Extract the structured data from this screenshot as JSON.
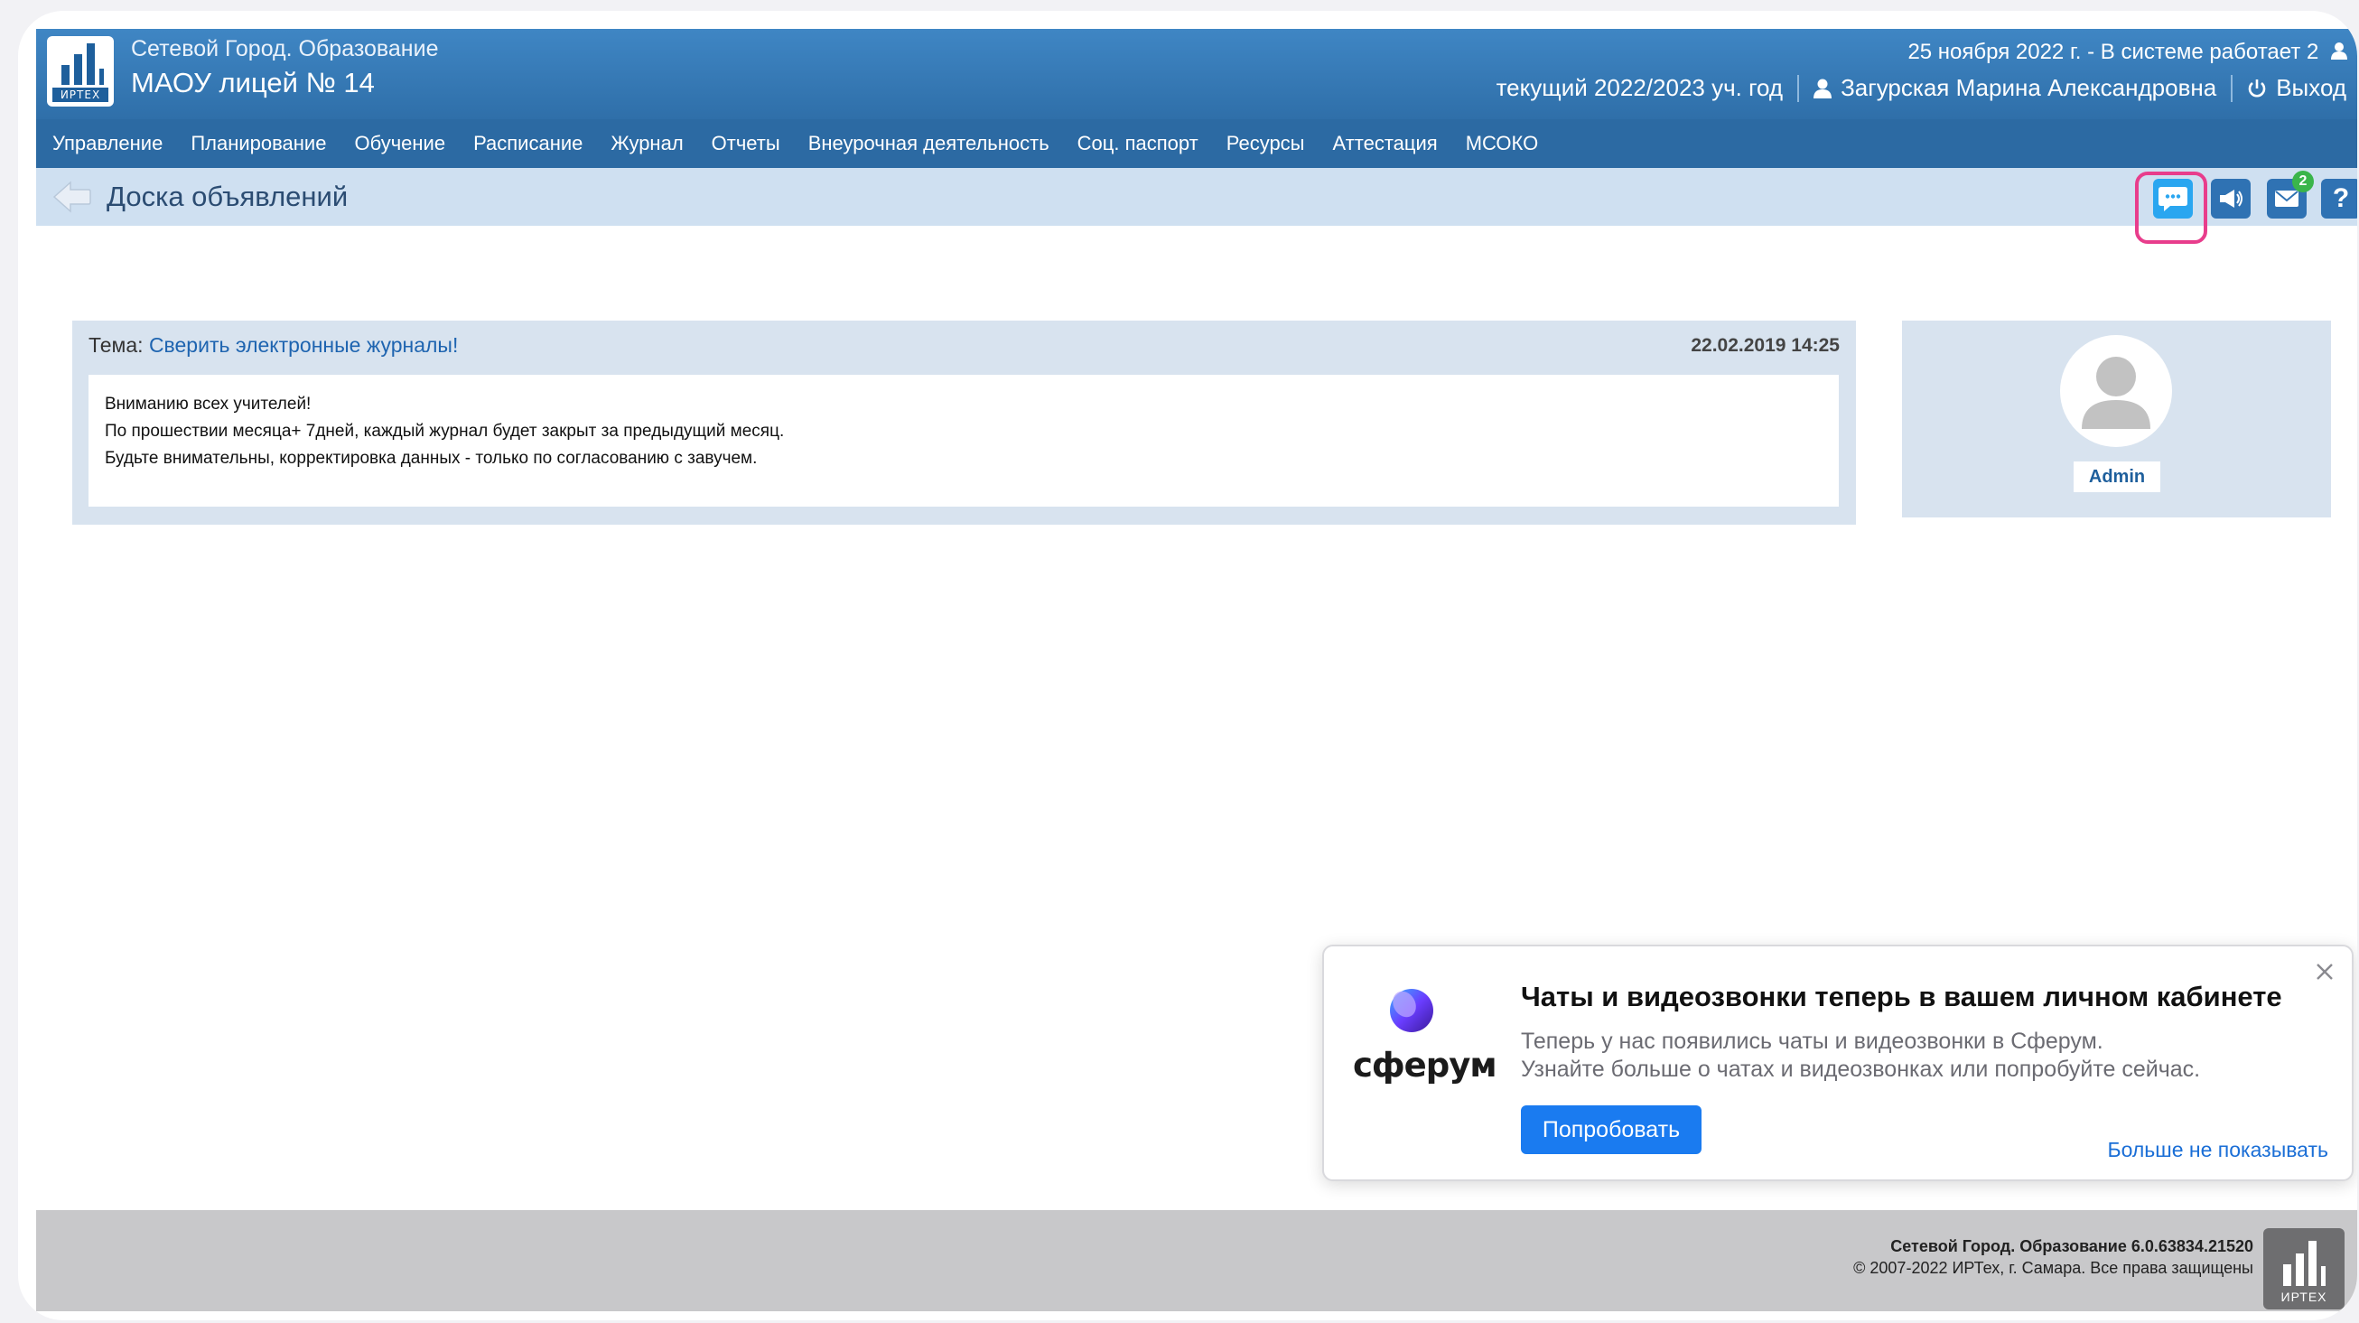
{
  "header": {
    "app_subtitle": "Сетевой Город. Образование",
    "school_name": "МАОУ лицей № 14",
    "date_status": "25 ноября 2022 г. - В системе работает 2",
    "academic_year": "текущий 2022/2023 уч. год",
    "user_name": "Загурская Марина Александровна",
    "logout_label": "Выход",
    "logo_text": "ИРТЕХ"
  },
  "menu": {
    "items": [
      "Управление",
      "Планирование",
      "Обучение",
      "Расписание",
      "Журнал",
      "Отчеты",
      "Внеурочная деятельность",
      "Соц. паспорт",
      "Ресурсы",
      "Аттестация",
      "МСОКО"
    ]
  },
  "titlebar": {
    "title": "Доска объявлений",
    "mail_badge": "2",
    "help_label": "?"
  },
  "announcement": {
    "topic_label": "Тема:",
    "topic_link": "Сверить электронные журналы!",
    "date": "22.02.2019 14:25",
    "lines": [
      "Вниманию всех учителей!",
      "По прошествии месяца+ 7дней, каждый журнал будет закрыт за предыдущий месяц.",
      "Будьте внимательны, корректировка данных - только по согласованию с завучем."
    ]
  },
  "author": {
    "name": "Admin"
  },
  "popup": {
    "brand": "сферум",
    "title": "Чаты и видеозвонки теперь в вашем личном кабинете",
    "text_line1": "Теперь у нас появились чаты и видеозвонки в Сферум.",
    "text_line2": "Узнайте больше о чатах и видеозвонках или попробуйте сейчас.",
    "button_label": "Попробовать",
    "dismiss_label": "Больше не показывать"
  },
  "footer": {
    "version": "Сетевой Город. Образование 6.0.63834.21520",
    "copyright": "© 2007-2022 ИРТех, г. Самара. Все права защищены",
    "logo_text": "ИРТЕХ"
  },
  "colors": {
    "header_blue": "#2f6fa9",
    "titlebar_blue": "#cfe0f1",
    "highlight_pink": "#e83d8c",
    "popup_button": "#1a7bf0"
  }
}
